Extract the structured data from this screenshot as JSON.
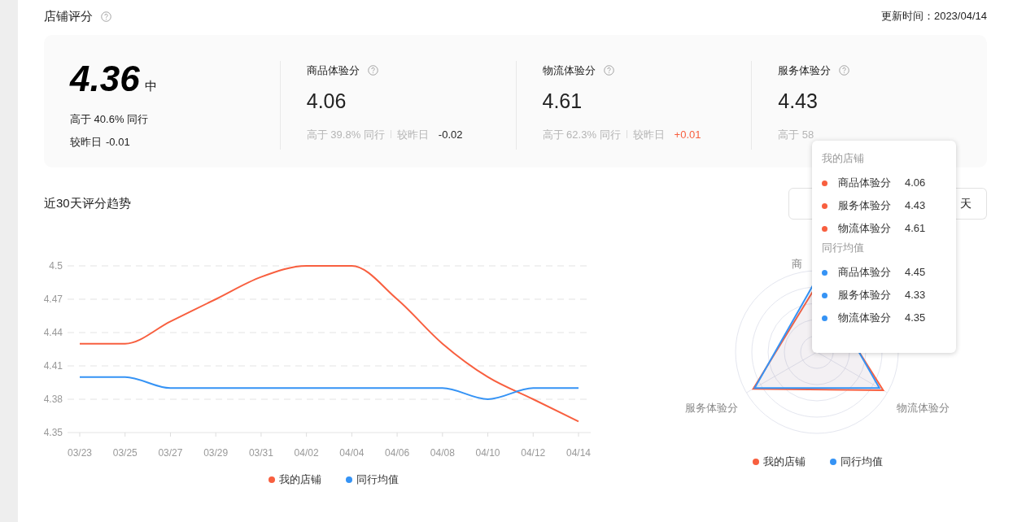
{
  "header": {
    "title": "店铺评分",
    "updated": "更新时间：2023/04/14"
  },
  "overall": {
    "score": "4.36",
    "grade": "中",
    "peer_text": "高于 40.6% 同行",
    "delta_label": "较昨日",
    "delta": "-0.01"
  },
  "metrics": [
    {
      "label": "商品体验分",
      "value": "4.06",
      "peer_text": "高于 39.8% 同行",
      "delta_label": "较昨日",
      "delta": "-0.02",
      "color": "#222222"
    },
    {
      "label": "物流体验分",
      "value": "4.61",
      "peer_text": "高于 62.3% 同行",
      "delta_label": "较昨日",
      "delta": "+0.01",
      "color": "#f85f3f"
    },
    {
      "label": "服务体验分",
      "value": "4.43",
      "peer_text": "高于 58"
    }
  ],
  "trend": {
    "title": "近30天评分趋势",
    "range_buttons": [
      {
        "selected": false
      },
      {
        "label": "天",
        "selected": false
      }
    ],
    "chart_data": {
      "type": "line",
      "x": [
        "03/23",
        "03/25",
        "03/27",
        "03/29",
        "03/31",
        "04/02",
        "04/04",
        "04/06",
        "04/08",
        "04/10",
        "04/12",
        "04/14"
      ],
      "ylim": [
        4.35,
        4.5
      ],
      "yticks": [
        4.35,
        4.38,
        4.41,
        4.44,
        4.47,
        4.5
      ],
      "grid": true,
      "legend": true,
      "series": [
        {
          "name": "我的店铺",
          "color": "#f85f3f",
          "values": [
            4.43,
            4.43,
            4.45,
            4.47,
            4.49,
            4.5,
            4.5,
            4.47,
            4.43,
            4.4,
            4.38,
            4.36
          ]
        },
        {
          "name": "同行均值",
          "color": "#3593f5",
          "values": [
            4.4,
            4.4,
            4.39,
            4.39,
            4.39,
            4.39,
            4.39,
            4.39,
            4.39,
            4.38,
            4.39,
            4.39
          ]
        }
      ]
    }
  },
  "radar": {
    "axis_labels": [
      "商",
      "服务体验分",
      "物流体验分"
    ],
    "legend": [
      {
        "label": "我的店铺",
        "color": "#f85f3f"
      },
      {
        "label": "同行均值",
        "color": "#3593f5"
      }
    ]
  },
  "tooltip": {
    "groups": [
      {
        "title": "我的店铺",
        "items": [
          {
            "label": "商品体验分",
            "value": "4.06",
            "color": "#f85f3f"
          },
          {
            "label": "服务体验分",
            "value": "4.43",
            "color": "#f85f3f"
          },
          {
            "label": "物流体验分",
            "value": "4.61",
            "color": "#f85f3f"
          }
        ]
      },
      {
        "title": "同行均值",
        "items": [
          {
            "label": "商品体验分",
            "value": "4.45",
            "color": "#3593f5"
          },
          {
            "label": "服务体验分",
            "value": "4.33",
            "color": "#3593f5"
          },
          {
            "label": "物流体验分",
            "value": "4.35",
            "color": "#3593f5"
          }
        ]
      }
    ]
  }
}
